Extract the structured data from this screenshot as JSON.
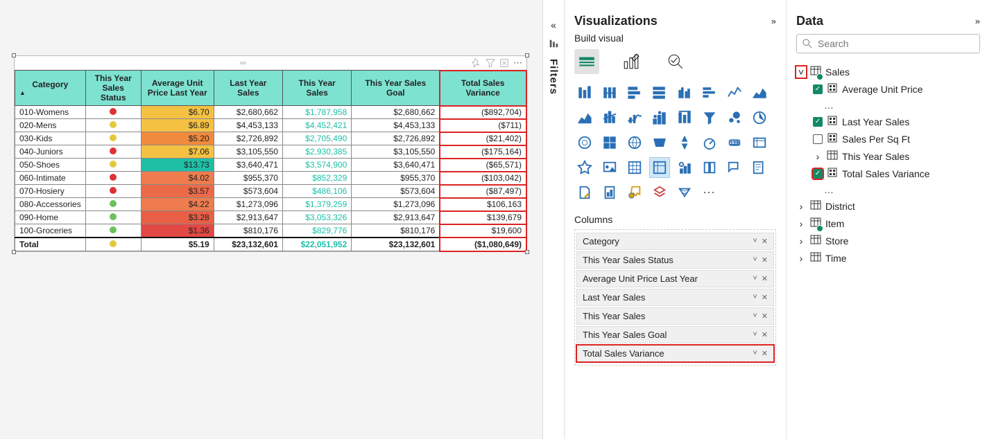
{
  "panels": {
    "visualizations_title": "Visualizations",
    "build_visual": "Build visual",
    "filters_label": "Filters",
    "columns_label": "Columns",
    "data_title": "Data",
    "search_placeholder": "Search"
  },
  "field_wells": [
    {
      "label": "Category",
      "highlight": false
    },
    {
      "label": "This Year Sales Status",
      "highlight": false
    },
    {
      "label": "Average Unit Price Last Year",
      "highlight": false
    },
    {
      "label": "Last Year Sales",
      "highlight": false
    },
    {
      "label": "This Year Sales",
      "highlight": false
    },
    {
      "label": "This Year Sales Goal",
      "highlight": false
    },
    {
      "label": "Total Sales Variance",
      "highlight": true
    }
  ],
  "data_tree": {
    "tables": [
      {
        "name": "Sales",
        "expanded": true,
        "has_measures": true,
        "highlight_exp": true,
        "fields": [
          {
            "name": "Average Unit Price",
            "checked": true,
            "icon": "measure"
          },
          {
            "name": "...",
            "ellipsis": true
          },
          {
            "name": "Last Year Sales",
            "checked": true,
            "icon": "measure"
          },
          {
            "name": "Sales Per Sq Ft",
            "checked": false,
            "icon": "measure"
          },
          {
            "name": "This Year Sales",
            "checked": null,
            "icon": "table",
            "expandable": true
          },
          {
            "name": "Total Sales Variance",
            "checked": true,
            "icon": "measure",
            "highlight_chk": true
          },
          {
            "name": "...",
            "ellipsis": true
          }
        ]
      },
      {
        "name": "District",
        "expanded": false
      },
      {
        "name": "Item",
        "expanded": false,
        "has_measures": true
      },
      {
        "name": "Store",
        "expanded": false
      },
      {
        "name": "Time",
        "expanded": false
      }
    ]
  },
  "table": {
    "headers": [
      "Category",
      "This Year Sales Status",
      "Average Unit Price Last Year",
      "Last Year Sales",
      "This Year Sales",
      "This Year Sales Goal",
      "Total Sales Variance"
    ],
    "rows": [
      {
        "cat": "010-Womens",
        "status": "#d33",
        "price": "$6.70",
        "price_bg": "#f5c143",
        "ly": "$2,680,662",
        "ty": "$1,787,958",
        "goal": "$2,680,662",
        "var": "($892,704)"
      },
      {
        "cat": "020-Mens",
        "status": "#e3c93a",
        "price": "$6.89",
        "price_bg": "#f5c143",
        "ly": "$4,453,133",
        "ty": "$4,452,421",
        "goal": "$4,453,133",
        "var": "($711)"
      },
      {
        "cat": "030-Kids",
        "status": "#e3c93a",
        "price": "$5.20",
        "price_bg": "#f08a3c",
        "ly": "$2,726,892",
        "ty": "$2,705,490",
        "goal": "$2,726,892",
        "var": "($21,402)"
      },
      {
        "cat": "040-Juniors",
        "status": "#d33",
        "price": "$7.06",
        "price_bg": "#f5c143",
        "ly": "$3,105,550",
        "ty": "$2,930,385",
        "goal": "$3,105,550",
        "var": "($175,164)"
      },
      {
        "cat": "050-Shoes",
        "status": "#e3c93a",
        "price": "$13.73",
        "price_bg": "#1fbfa6",
        "ly": "$3,640,471",
        "ty": "$3,574,900",
        "goal": "$3,640,471",
        "var": "($65,571)"
      },
      {
        "cat": "060-Intimate",
        "status": "#d33",
        "price": "$4.02",
        "price_bg": "#ee7c4e",
        "ly": "$955,370",
        "ty": "$852,329",
        "goal": "$955,370",
        "var": "($103,042)"
      },
      {
        "cat": "070-Hosiery",
        "status": "#d33",
        "price": "$3.57",
        "price_bg": "#eb6a48",
        "ly": "$573,604",
        "ty": "$486,106",
        "goal": "$573,604",
        "var": "($87,497)"
      },
      {
        "cat": "080-Accessories",
        "status": "#6ac25a",
        "price": "$4.22",
        "price_bg": "#ee7c4e",
        "ly": "$1,273,096",
        "ty": "$1,379,259",
        "goal": "$1,273,096",
        "var": "$106,163"
      },
      {
        "cat": "090-Home",
        "status": "#6ac25a",
        "price": "$3.28",
        "price_bg": "#e85f46",
        "ly": "$2,913,647",
        "ty": "$3,053,326",
        "goal": "$2,913,647",
        "var": "$139,679"
      },
      {
        "cat": "100-Groceries",
        "status": "#6ac25a",
        "price": "$1.36",
        "price_bg": "#e24844",
        "ly": "$810,176",
        "ty": "$829,776",
        "goal": "$810,176",
        "var": "$19,600"
      }
    ],
    "total": {
      "cat": "Total",
      "status": "#e3c93a",
      "price": "$5.19",
      "ly": "$23,132,601",
      "ty": "$22,051,952",
      "goal": "$23,132,601",
      "var": "($1,080,649)"
    }
  }
}
